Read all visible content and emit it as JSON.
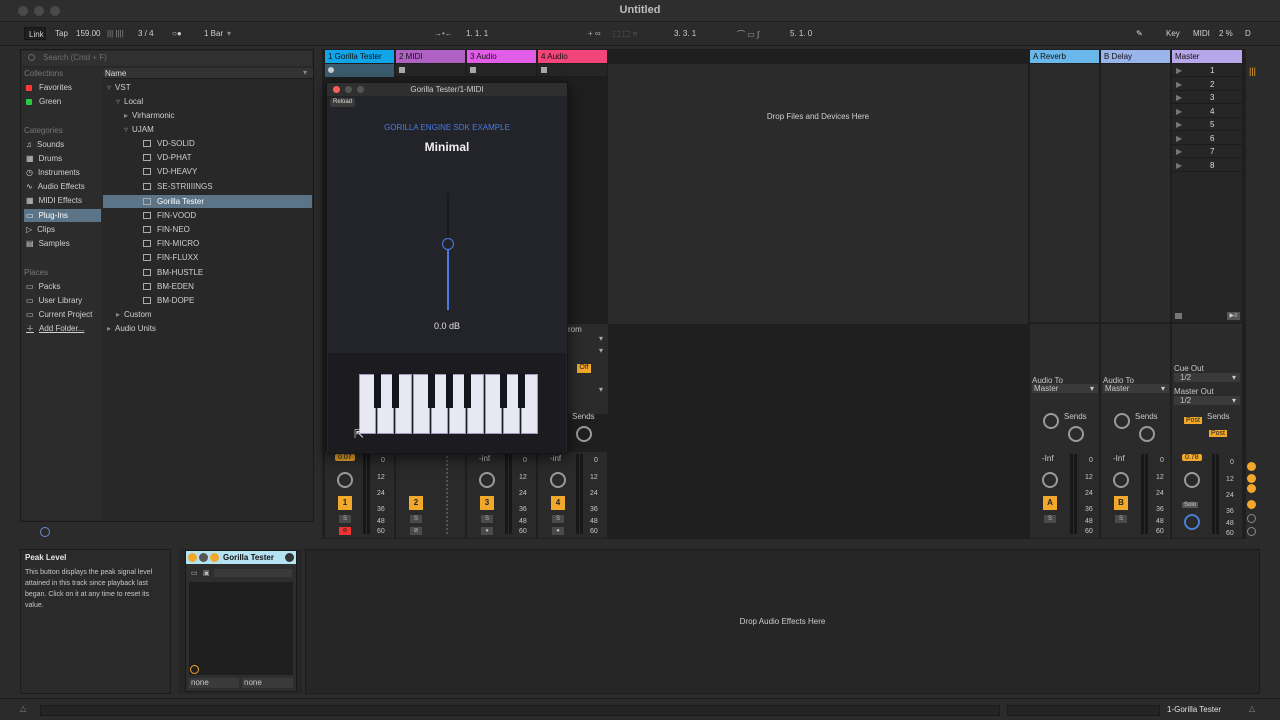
{
  "window": {
    "title": "Untitled"
  },
  "controlbar": {
    "link": "Link",
    "tap": "Tap",
    "tempo": "159.00",
    "sig": "3 / 4",
    "quant": "1 Bar",
    "pos1": "1.   1.   1",
    "pos2": "3.   3.   1",
    "pos3": "5.   1.   0",
    "key": "Key",
    "midi": "MIDI",
    "cpu": "2 %",
    "d": "D"
  },
  "browser": {
    "search_placeholder": "Search (Cmd + F)",
    "collections_label": "Collections",
    "collections": [
      {
        "label": "Favorites",
        "color": "#ff3b30"
      },
      {
        "label": "Green",
        "color": "#28c840"
      }
    ],
    "categories_label": "Categories",
    "categories": [
      "Sounds",
      "Drums",
      "Instruments",
      "Audio Effects",
      "MIDI Effects",
      "Plug-Ins",
      "Clips",
      "Samples"
    ],
    "places_label": "Places",
    "places": [
      "Packs",
      "User Library",
      "Current Project",
      "Add Folder..."
    ],
    "name_header": "Name",
    "tree": {
      "vst": "VST",
      "local": "Local",
      "virharmonic": "Virharmonic",
      "ujam": "UJAM",
      "plugins": [
        "VD-SOLID",
        "VD-PHAT",
        "VD-HEAVY",
        "SE-STRIIIINGS",
        "Gorilla Tester",
        "FIN-VOOD",
        "FIN-NEO",
        "FIN-MICRO",
        "FIN-FLUXX",
        "BM-HUSTLE",
        "BM-EDEN",
        "BM-DOPE"
      ],
      "custom": "Custom",
      "audio_units": "Audio Units"
    }
  },
  "tracks": [
    {
      "name": "1 Gorilla Tester",
      "color": "#10a4e8",
      "vol": "0.07",
      "num": "1"
    },
    {
      "name": "2 MIDI",
      "color": "#b061c4",
      "vol": "",
      "num": "2"
    },
    {
      "name": "3 Audio",
      "color": "#e35ee8",
      "vol": "-inf",
      "num": "3"
    },
    {
      "name": "4 Audio",
      "color": "#f2467a",
      "vol": "-inf",
      "num": "4"
    }
  ],
  "returns": [
    {
      "name": "A Reverb",
      "color": "#6ab7ec",
      "vol": "-Inf",
      "num": "A",
      "audio_to_label": "Audio To",
      "audio_to": "Master"
    },
    {
      "name": "B Delay",
      "color": "#9ab4ec",
      "vol": "-Inf",
      "num": "B",
      "audio_to_label": "Audio To",
      "audio_to": "Master"
    }
  ],
  "master": {
    "name": "Master",
    "color": "#b6a6ea",
    "scenes": [
      "1",
      "2",
      "3",
      "4",
      "5",
      "6",
      "7",
      "8"
    ],
    "cue_out_label": "Cue Out",
    "cue_out": "1/2",
    "master_out_label": "Master Out",
    "master_out": "1/2",
    "vol": "0.78",
    "solo": "Solo",
    "post": "Post"
  },
  "session": {
    "drop_files": "Drop Files and Devices Here",
    "sends": "Sends",
    "from": "rom",
    "off": "Off",
    "meter_ticks": [
      "0",
      "12",
      "24",
      "36",
      "48",
      "60"
    ]
  },
  "plugin": {
    "window_title": "Gorilla Tester/1-MIDI",
    "reload": "Reload",
    "subtitle": "GORILLA ENGINE SDK EXAMPLE",
    "title": "Minimal",
    "gain": "0.0 dB",
    "slider_level": 0.56
  },
  "info": {
    "title": "Peak Level",
    "text": "This button displays the peak signal level attained in this track since playback last began. Click on it at any time to reset its value."
  },
  "device": {
    "name": "Gorilla Tester",
    "in1": "none",
    "in2": "none",
    "drop_fx": "Drop Audio Effects Here"
  },
  "statusbar": {
    "track": "1-Gorilla Tester"
  }
}
